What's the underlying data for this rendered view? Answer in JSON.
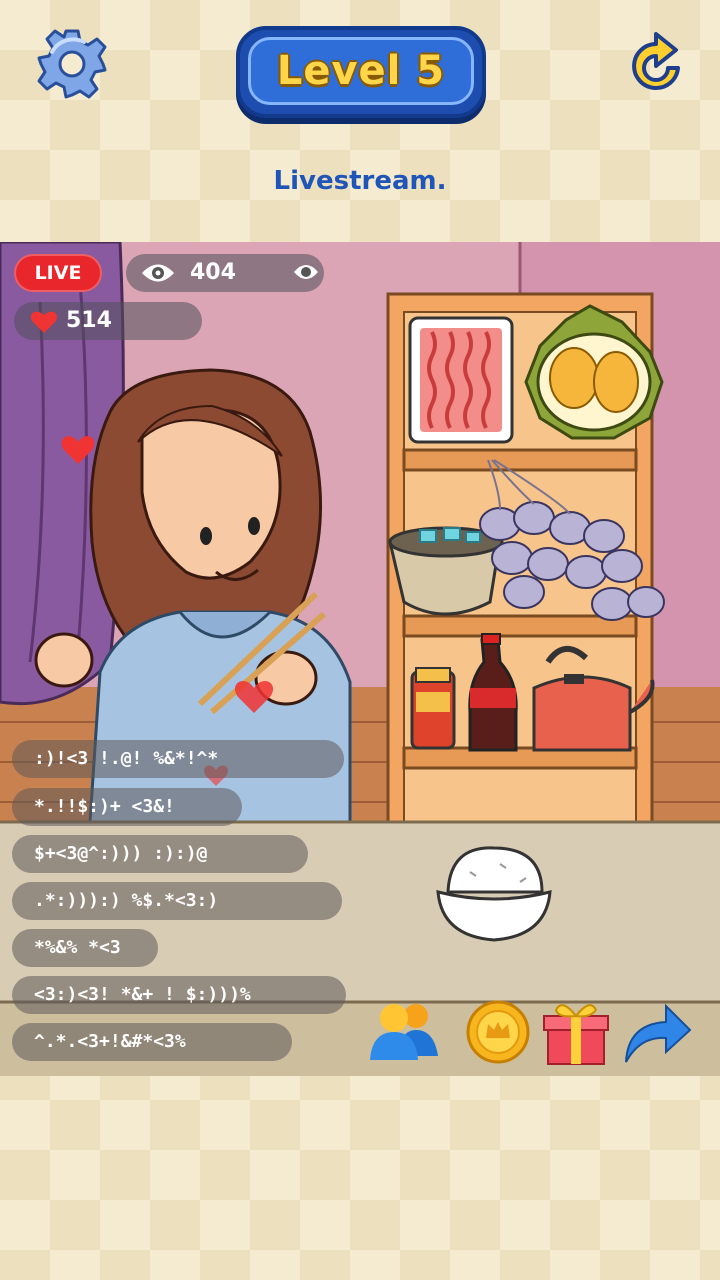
{
  "header": {
    "level_label": "Level 5",
    "hint_text": "Livestream."
  },
  "stream": {
    "live_label": "LIVE",
    "viewer_count": "404",
    "like_count": "514"
  },
  "chat": [
    ":)!<3  !.@!  %&*!^*",
    "*.!!$:)+  <3&!",
    "$+<3@^:))) :):)@",
    ".*:))):) %$.*<3:)",
    "*%&% *<3",
    "<3:)<3!  *&+ ! $:)))%",
    "^.*.<3+!&#*<3%"
  ],
  "actions": [
    "friends-icon",
    "coin-icon",
    "gift-icon",
    "share-icon"
  ],
  "colors": {
    "background": "#f4ebd0",
    "level_badge": "#2f6ed8",
    "level_text": "#ffd64a",
    "hint_text": "#1f55b8",
    "live_badge": "#e8262b"
  }
}
